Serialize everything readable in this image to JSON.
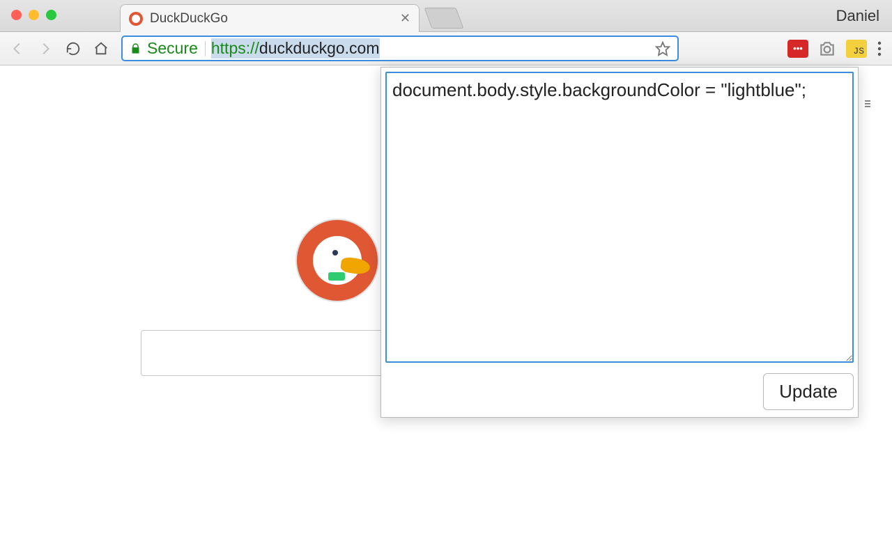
{
  "window": {
    "profile_name": "Daniel",
    "tab_title": "DuckDuckGo"
  },
  "toolbar": {
    "secure_label": "Secure",
    "url_protocol": "https://",
    "url_host": "duckduckgo.com"
  },
  "extensions": {
    "lastpass_symbol": "•••",
    "js_label": "JS"
  },
  "popup": {
    "code": "document.body.style.backgroundColor = \"lightblue\";",
    "update_label": "Update"
  }
}
